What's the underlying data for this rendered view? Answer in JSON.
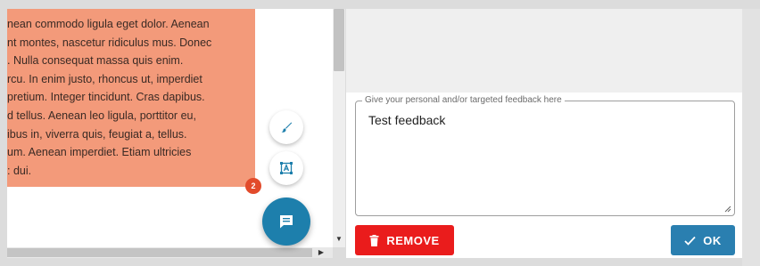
{
  "document": {
    "lines": [
      "nean commodo ligula eget dolor. Aenean",
      "nt montes, nascetur ridiculus mus. Donec",
      ". Nulla consequat massa quis enim.",
      "rcu. In enim justo, rhoncus ut, imperdiet",
      "pretium. Integer tincidunt. Cras dapibus.",
      "d tellus. Aenean leo ligula, porttitor eu,",
      "ibus in, viverra quis, feugiat a, tellus.",
      "um. Aenean imperdiet. Etiam ultricies",
      ": dui."
    ],
    "highlight_color": "#f39a7a"
  },
  "tools": {
    "brush_icon": "paintbrush-icon",
    "text_icon": "text-box-icon",
    "comment_icon": "comment-icon",
    "badge_count": "2"
  },
  "feedback": {
    "legend": "Give your personal and/or targeted feedback here",
    "value": "Test feedback"
  },
  "actions": {
    "remove_label": "REMOVE",
    "ok_label": "OK",
    "remove_color": "#ea1c1c",
    "ok_color": "#2a7fb0"
  }
}
